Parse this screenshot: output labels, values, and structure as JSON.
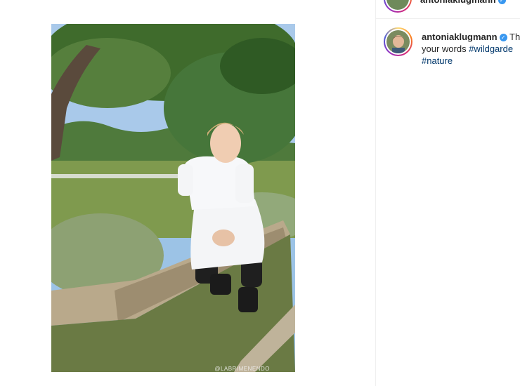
{
  "post": {
    "watermark": "@LABRIMENENDO",
    "photo_alt": "woman in white chef outfit seated on a raised garden bed"
  },
  "header": {
    "username": "antoniaklugmann",
    "verified_glyph": "✓"
  },
  "caption": {
    "username": "antoniaklugmann",
    "verified_glyph": "✓",
    "text_start": "Th",
    "line2_text": "your words ",
    "hashtag1": "#wildgarde",
    "hashtag2": "#nature"
  },
  "colors": {
    "hashtag": "#00376b",
    "verified": "#3897f0",
    "story_ring": [
      "#feda75",
      "#fa7e1e",
      "#d62976",
      "#962fbf",
      "#4f5bd5"
    ]
  }
}
